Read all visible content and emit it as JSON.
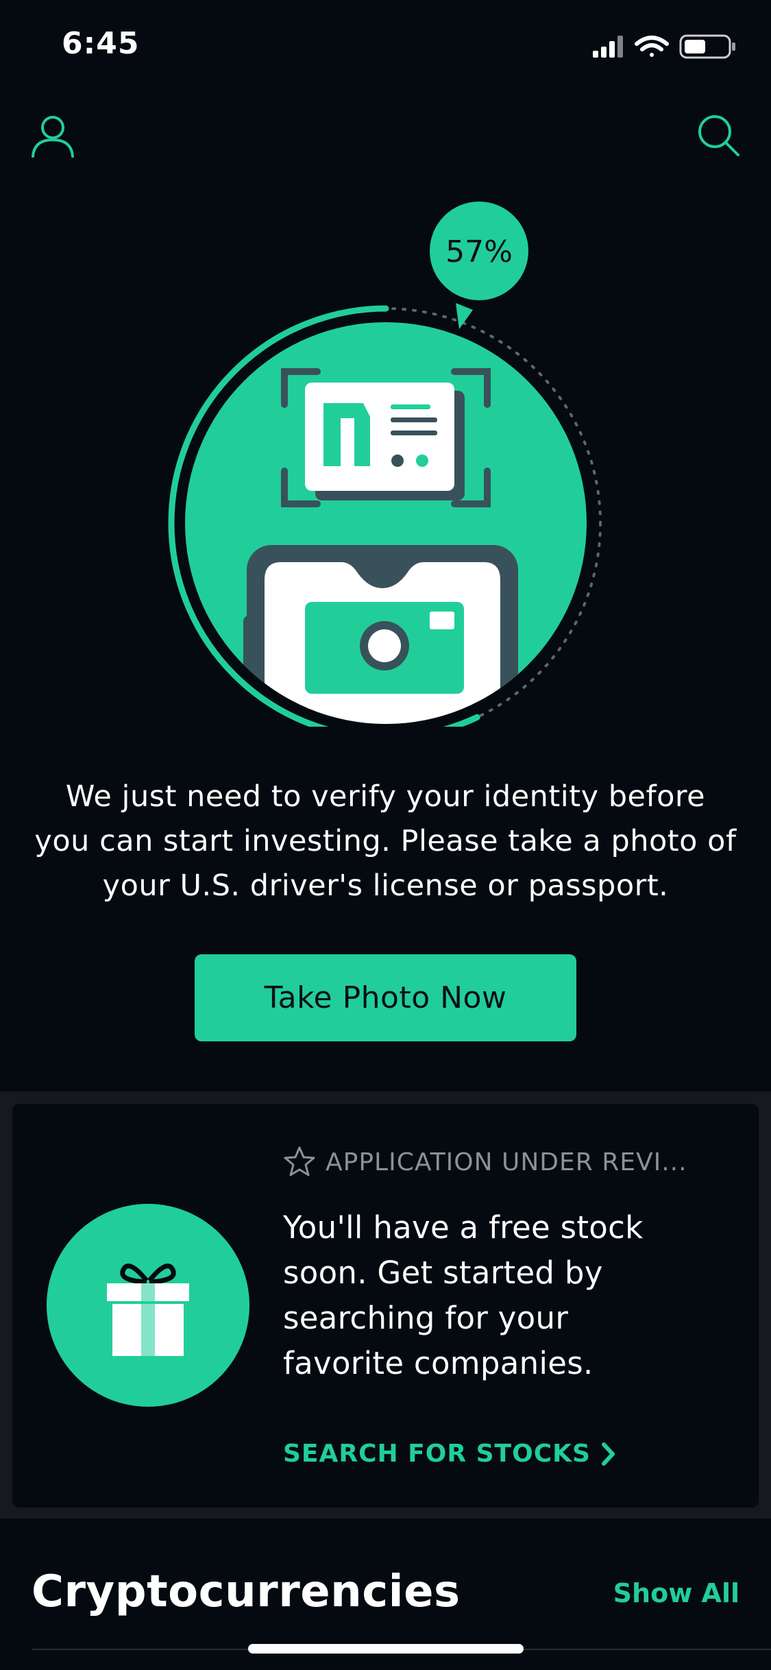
{
  "status_bar": {
    "time": "6:45"
  },
  "verification": {
    "progress_label": "57%",
    "progress": 0.57,
    "message": "We just need to verify your identity before you can start investing. Please take a photo of your U.S. driver's license or passport.",
    "cta_label": "Take Photo Now"
  },
  "review_card": {
    "status_label": "APPLICATION UNDER REVI...",
    "body": "You'll have a free stock soon. Get started by searching for your favorite companies.",
    "link_label": "SEARCH FOR STOCKS"
  },
  "crypto_section": {
    "title": "Cryptocurrencies",
    "show_all_label": "Show All"
  },
  "colors": {
    "background": "#050a11",
    "accent": "#21ce99",
    "card_band": "#16191d",
    "muted_text": "#8c9196",
    "illustration_dark": "#39515a"
  },
  "icons": {
    "profile": "person-outline-icon",
    "search": "magnifier-icon",
    "status_label": "star-outline-icon",
    "link": "chevron-right-icon",
    "gift": "gift-icon",
    "id_card": "id-card-icon",
    "camera": "camera-icon"
  }
}
